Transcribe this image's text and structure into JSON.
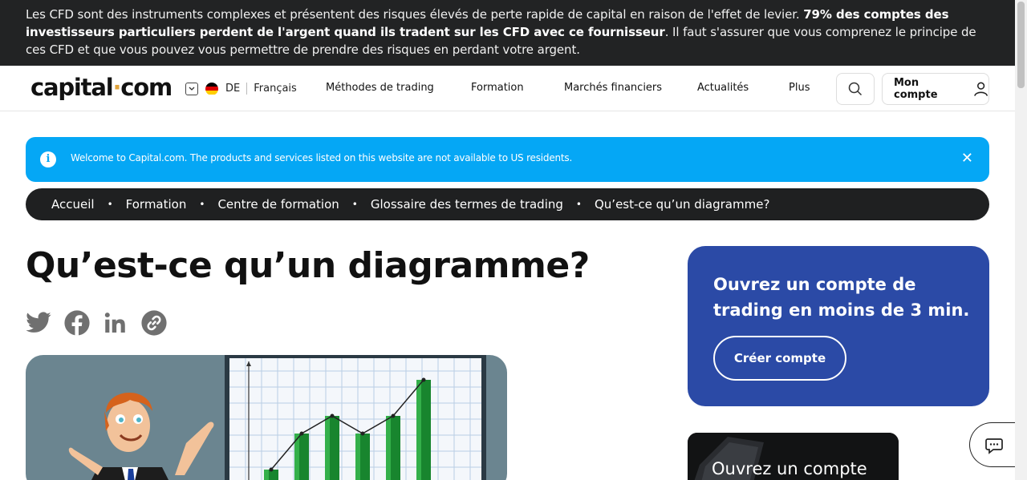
{
  "risk_warning": {
    "part1": "Les CFD sont des instruments complexes et présentent des risques élevés de perte rapide de capital en raison de l'effet de levier. ",
    "bold": "79% des comptes des investisseurs particuliers perdent de l'argent quand ils tradent sur les CFD avec ce fournisseur",
    "part2": ". Il faut s'assurer que vous comprenez le principe de ces CFD et que vous pouvez vous permettre de prendre des risques en perdant votre argent."
  },
  "header": {
    "logo_left": "capital",
    "logo_dot": "·",
    "logo_right": "com",
    "country_code": "DE",
    "language": "Français",
    "nav": [
      "Méthodes de trading",
      "Formation",
      "Marchés financiers",
      "Actualités",
      "Plus"
    ],
    "account_label": "Mon compte"
  },
  "banner": {
    "info_glyph": "i",
    "message": "Welcome to Capital.com. The products and services listed on this website are not available to US residents.",
    "close_glyph": "✕"
  },
  "breadcrumb": [
    "Accueil",
    "Formation",
    "Centre de formation",
    "Glossaire des termes de trading",
    "Qu’est-ce qu’un diagramme?"
  ],
  "breadcrumb_sep": "•",
  "page_title": "Qu’est-ce qu’un diagramme?",
  "share": [
    "twitter-icon",
    "facebook-icon",
    "linkedin-icon",
    "copy-link-icon"
  ],
  "cta": {
    "text": "Ouvrez un compte de trading en moins de 3 min.",
    "button": "Créer compte"
  },
  "promo_card": {
    "text": "Ouvrez un compte"
  },
  "colors": {
    "risk_bg": "#222324",
    "banner_bg": "#05a7f5",
    "crumbs_bg": "#1f2021",
    "cta_bg": "#2b4aa6",
    "logo_dot": "#e0a33b"
  }
}
